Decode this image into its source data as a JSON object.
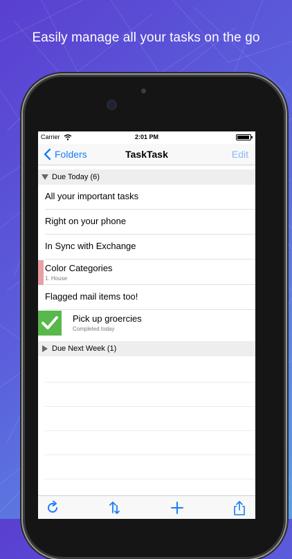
{
  "headline": "Easily manage all your tasks on the go",
  "status": {
    "carrier": "Carrier",
    "time": "2:01 PM"
  },
  "navbar": {
    "back_label": "Folders",
    "title": "TaskTask",
    "edit_label": "Edit"
  },
  "sections": [
    {
      "label": "Due Today (6)",
      "expanded": true
    },
    {
      "label": "Due Next Week (1)",
      "expanded": false
    }
  ],
  "tasks": [
    {
      "title": "All your important tasks",
      "subtitle": ""
    },
    {
      "title": "Right on your phone",
      "subtitle": ""
    },
    {
      "title": "In Sync with Exchange",
      "subtitle": ""
    },
    {
      "title": "Color Categories",
      "subtitle": "1. House",
      "category_color": "#e8a0a4"
    },
    {
      "title": "Flagged mail items too!",
      "subtitle": ""
    },
    {
      "title": "Pick up groercies",
      "subtitle": "Completed today",
      "completed": true,
      "check_color": "#59b84b"
    }
  ],
  "toolbar": {
    "icons": [
      "refresh-icon",
      "sort-icon",
      "add-icon",
      "share-icon"
    ]
  },
  "colors": {
    "accent": "#1a7cf5",
    "edit_disabled": "#8ab9f5",
    "section_bg": "#eeeeee"
  }
}
